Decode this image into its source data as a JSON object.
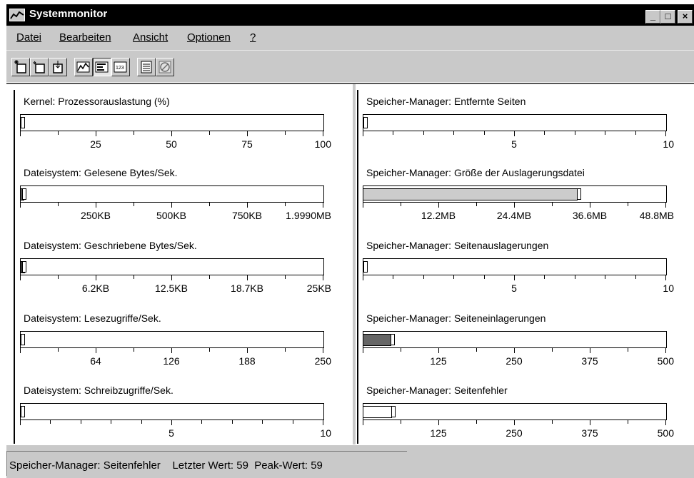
{
  "window": {
    "title": "Systemmonitor"
  },
  "caption_buttons": {
    "minimize": "_",
    "maximize": "□",
    "close": "×"
  },
  "menu": [
    {
      "label": "Datei",
      "mnemonic": "D"
    },
    {
      "label": "Bearbeiten",
      "mnemonic": "B"
    },
    {
      "label": "Ansicht",
      "mnemonic": "A"
    },
    {
      "label": "Optionen",
      "mnemonic": "O"
    },
    {
      "label": "?",
      "mnemonic": "?"
    }
  ],
  "toolbar": {
    "buttons": [
      {
        "name": "new-settings-icon",
        "pressed": false,
        "disabled": false
      },
      {
        "name": "open-settings-icon",
        "pressed": false,
        "disabled": false
      },
      {
        "name": "save-settings-icon",
        "pressed": false,
        "disabled": false
      },
      {
        "name": "line-chart-icon",
        "pressed": false,
        "disabled": false
      },
      {
        "name": "bar-chart-icon",
        "pressed": true,
        "disabled": false
      },
      {
        "name": "numeric-view-icon",
        "pressed": false,
        "disabled": false
      },
      {
        "name": "properties-icon",
        "pressed": false,
        "disabled": false
      },
      {
        "name": "delete-icon",
        "pressed": false,
        "disabled": true
      }
    ]
  },
  "meters": [
    {
      "label": "Kernel: Prozessorauslastung (%)",
      "ticks": [
        "25",
        "50",
        "75",
        "100"
      ],
      "major": 4,
      "minor": 1,
      "value": 0.0,
      "peak": 0.0,
      "fill_color": "#ffffff"
    },
    {
      "label": "Speicher-Manager: Entfernte Seiten",
      "ticks": [
        "5",
        "10"
      ],
      "major": 2,
      "minor": 4,
      "value": 0.0,
      "peak": 0.0,
      "fill_color": "#ffffff"
    },
    {
      "label": "Dateisystem: Gelesene Bytes/Sek.",
      "ticks": [
        "250KB",
        "500KB",
        "750KB",
        "1.9990MB"
      ],
      "major": 4,
      "minor": 1,
      "value": 0.01,
      "peak": 0.005,
      "fill_color": "#555555"
    },
    {
      "label": "Speicher-Manager: Größe der Auslagerungsdatei",
      "ticks": [
        "12.2MB",
        "24.4MB",
        "36.6MB",
        "48.8MB"
      ],
      "major": 4,
      "minor": 1,
      "value": 0.705,
      "peak": 0.705,
      "fill_color": "#cccccc"
    },
    {
      "label": "Dateisystem: Geschriebene Bytes/Sek.",
      "ticks": [
        "6.2KB",
        "12.5KB",
        "18.7KB",
        "25KB"
      ],
      "major": 4,
      "minor": 1,
      "value": 0.012,
      "peak": 0.005,
      "fill_color": "#333333"
    },
    {
      "label": "Speicher-Manager: Seitenauslagerungen",
      "ticks": [
        "5",
        "10"
      ],
      "major": 2,
      "minor": 4,
      "value": 0.0,
      "peak": 0.0,
      "fill_color": "#ffffff"
    },
    {
      "label": "Dateisystem: Lesezugriffe/Sek.",
      "ticks": [
        "64",
        "126",
        "188",
        "250"
      ],
      "major": 4,
      "minor": 1,
      "value": 0.0,
      "peak": 0.0,
      "fill_color": "#ffffff"
    },
    {
      "label": "Speicher-Manager: Seiteneinlagerungen",
      "ticks": [
        "125",
        "250",
        "375",
        "500"
      ],
      "major": 4,
      "minor": 1,
      "value": 0.09,
      "peak": 0.09,
      "fill_color": "#666666"
    },
    {
      "label": "Dateisystem: Schreibzugriffe/Sek.",
      "ticks": [
        "5",
        "10"
      ],
      "major": 2,
      "minor": 4,
      "value": 0.0,
      "peak": 0.0,
      "fill_color": "#ffffff"
    },
    {
      "label": "Speicher-Manager: Seitenfehler",
      "ticks": [
        "125",
        "250",
        "375",
        "500"
      ],
      "major": 4,
      "minor": 1,
      "value": 0.092,
      "peak": 0.092,
      "fill_color": "#ffffff"
    }
  ],
  "status": {
    "counter": "Speicher-Manager: Seitenfehler",
    "last_label": "Letzter Wert:",
    "last_value": "59",
    "peak_label": "Peak-Wert:",
    "peak_value": "59"
  }
}
